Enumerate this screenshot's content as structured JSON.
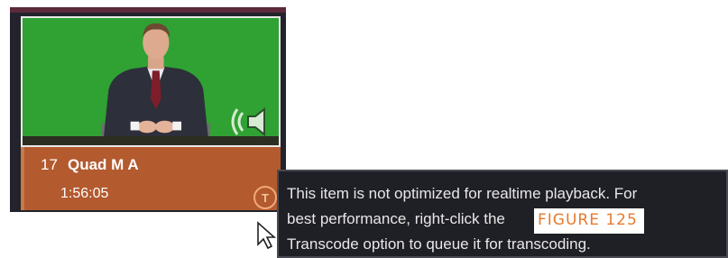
{
  "clip": {
    "number": "17",
    "name": "Quad M A",
    "duration": "1:56:05",
    "transcode_badge": "T",
    "thumbnail_icon": "speaker-audio-icon"
  },
  "tooltip": {
    "lines": [
      "This item is not optimized for realtime playback. For",
      "best performance, right-click the",
      "Transcode option to queue it for transcoding."
    ]
  },
  "figure": {
    "label": "FIGURE 125"
  },
  "colors": {
    "thumbnail_bg": "#2fa233",
    "info_bar": "#b35a2e",
    "top_bar": "#5c2a3b",
    "figure_label": "#e67a2e",
    "tooltip_bg": "#1f1f26"
  }
}
